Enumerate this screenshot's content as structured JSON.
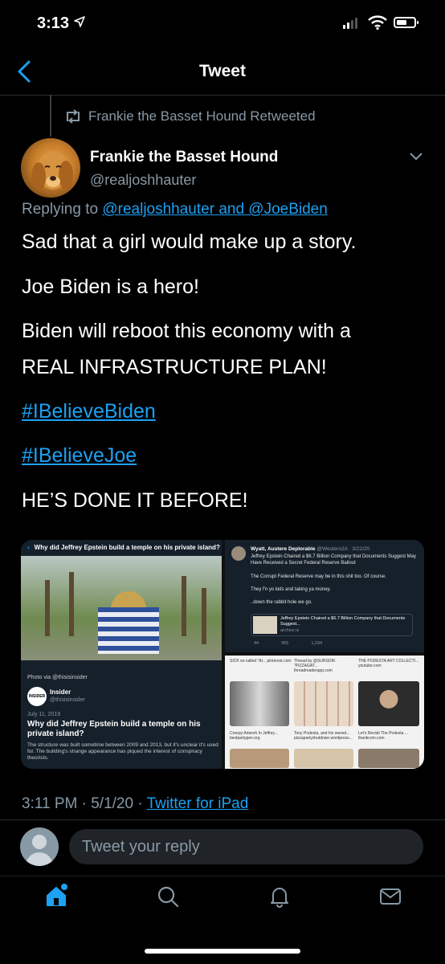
{
  "status_bar": {
    "time": "3:13"
  },
  "header": {
    "title": "Tweet"
  },
  "retweet": {
    "label": "Frankie the Basset Hound Retweeted"
  },
  "author": {
    "name": "Frankie the Basset Hound",
    "handle": "@realjoshhauter"
  },
  "reply_context": {
    "prefix": "Replying to ",
    "mentions": "@realjoshhauter and @JoeBiden"
  },
  "body": {
    "line1": "Sad that a girl would make up a story.",
    "line2": "Joe Biden is a hero!",
    "line3a": "Biden will reboot this economy with a",
    "line3b": "REAL INFRASTRUCTURE PLAN!",
    "hashtag1": "#IBelieveBiden",
    "hashtag2": "#IBelieveJoe",
    "line4": "HE’S DONE IT BEFORE!"
  },
  "media": {
    "left": {
      "header": "Why did Jeffrey Epstein build a temple on his private island?",
      "photo_caption": "Photo via @thisisinsider",
      "logo_text": "INSIDER",
      "source_name": "Insider",
      "source_handle": "@thisisinsider",
      "date": "July 11, 2019",
      "headline": "Why did Jeffrey Epstein build a temple on his private island?",
      "blurb": "The structure was built sometime between 2009 and 2013, but it's unclear it's used for. The building's strange appearance has piqued the interest of conspiracy theorists."
    },
    "right_top": {
      "name": "Wyatt, Austere Deplorable",
      "handle_date": "@Western2A · 3/22/20",
      "text1": "Jeffrey Epstein Chaired a $6.7 Billion Company that Documents Suggest May Have Received a Secret Federal Reserve Bailout",
      "text2": "The Corrupt Federal Reserve may be in this shit too. Of course.",
      "text3": "They f'n yo kids and taking ya money.",
      "text4": "..down the rabbit hole we go.",
      "card_title": "Jeffrey Epstein Chaired a $6.7 Billion Company that Documents Suggest...",
      "card_domain": "archive.is",
      "replies": "44",
      "retweets": "965",
      "likes": "1,294"
    },
    "right_bottom": {
      "pin1": "SICK so-called \"Ar... pinterest.com",
      "pin2": "Thread by @SURSDIK: \"PIZZAGAT... threadreaderapp.com",
      "pin3": "THE PODESTA ART COLLECTI... youtube.com",
      "pin4": "Creepy Artwork In Jeffrey... bestpartypen.org",
      "pin5": "Tony Podesta, and his owned... pizzapartyshutdown.wordpress...",
      "pin6": "Let's Revisit The Podesta ... thankcom.com"
    }
  },
  "meta": {
    "timestamp": "3:11 PM · 5/1/20 · ",
    "source": "Twitter for iPad"
  },
  "reply_box": {
    "placeholder": "Tweet your reply"
  },
  "colors": {
    "accent": "#1da1f2",
    "muted": "#8899a6",
    "background": "#000000"
  },
  "icons": [
    "location-arrow-icon",
    "signal-icon",
    "wifi-icon",
    "battery-icon",
    "back-arrow-icon",
    "retweet-icon",
    "chevron-down-icon",
    "home-icon",
    "search-icon",
    "bell-icon",
    "mail-icon"
  ]
}
